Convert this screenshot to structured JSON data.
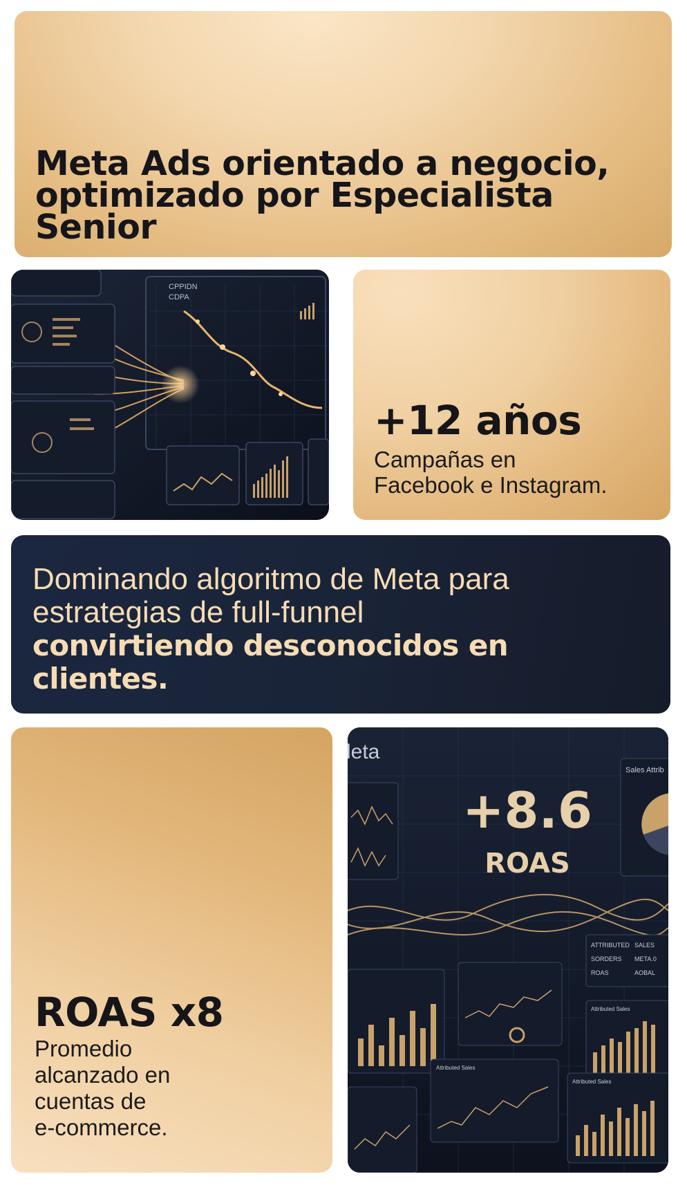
{
  "hero": {
    "title_line1": "Meta Ads orientado a negocio,",
    "title_line2": "optimizado por Especialista",
    "title_line3": "Senior"
  },
  "dashboard1": {
    "label_1": "CPPIDN",
    "label_2": "CDPA"
  },
  "years_card": {
    "value": "+12 años",
    "desc_line1": "Campañas en",
    "desc_line2": "Facebook e Instagram."
  },
  "banner": {
    "line1": "Dominando algoritmo de Meta para",
    "line2": "estrategias de full-funnel",
    "line3_bold": "convirtiendo desconocidos en",
    "line4_bold": "clientes."
  },
  "roas_card": {
    "value": "ROAS x8",
    "desc_line1": "Promedio",
    "desc_line2": "alcanzado en",
    "desc_line3": "cuentas de",
    "desc_line4": "e-commerce."
  },
  "dashboard2": {
    "brand": "leta",
    "big_value": "+8.6",
    "big_label": "ROAS",
    "panel_title": "Sales Attrib",
    "table_row1_label": "ATTRIBUTED",
    "table_row1_value": "SALES",
    "table_row2_label": "SORDERS",
    "table_row2_value": "META.0",
    "table_row3_label": "ROAS",
    "table_row3_value": "AOBAL",
    "mini1": "Attributed Sales",
    "mini2": "Attributed Sales",
    "mini3": "Attributed Sales"
  },
  "colors": {
    "gold_light": "#fbe6c6",
    "gold_dark": "#d5a562",
    "navy": "#1b2740",
    "cream_text": "#f6dcb4"
  }
}
